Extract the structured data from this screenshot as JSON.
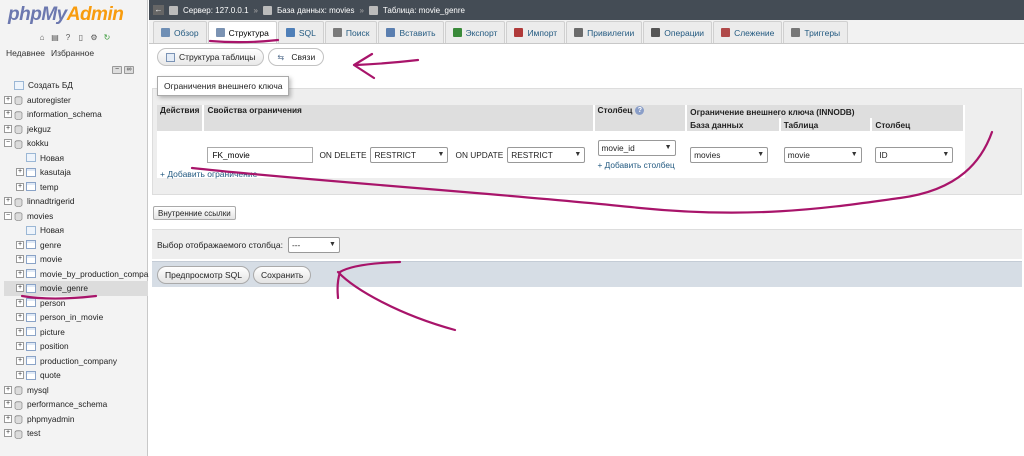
{
  "logo": {
    "php": "php",
    "my": "My",
    "admin": "Admin"
  },
  "nav": {
    "tab_recent": "Недавнее",
    "tab_favorites": "Избранное",
    "items": [
      {
        "label": "Создать БД",
        "level": 0,
        "kind": "new"
      },
      {
        "label": "autoregister",
        "level": 0,
        "kind": "db"
      },
      {
        "label": "information_schema",
        "level": 0,
        "kind": "db"
      },
      {
        "label": "jekguz",
        "level": 0,
        "kind": "db"
      },
      {
        "label": "kokku",
        "level": 0,
        "kind": "db"
      },
      {
        "label": "Новая",
        "level": 1,
        "kind": "new"
      },
      {
        "label": "kasutaja",
        "level": 1,
        "kind": "table"
      },
      {
        "label": "temp",
        "level": 1,
        "kind": "table"
      },
      {
        "label": "linnadtrigerid",
        "level": 0,
        "kind": "db"
      },
      {
        "label": "movies",
        "level": 0,
        "kind": "db"
      },
      {
        "label": "Новая",
        "level": 1,
        "kind": "new"
      },
      {
        "label": "genre",
        "level": 1,
        "kind": "table"
      },
      {
        "label": "movie",
        "level": 1,
        "kind": "table"
      },
      {
        "label": "movie_by_production_compa",
        "level": 1,
        "kind": "table"
      },
      {
        "label": "movie_genre",
        "level": 1,
        "kind": "table",
        "selected": true
      },
      {
        "label": "person",
        "level": 1,
        "kind": "table"
      },
      {
        "label": "person_in_movie",
        "level": 1,
        "kind": "table"
      },
      {
        "label": "picture",
        "level": 1,
        "kind": "table"
      },
      {
        "label": "position",
        "level": 1,
        "kind": "table"
      },
      {
        "label": "production_company",
        "level": 1,
        "kind": "table"
      },
      {
        "label": "quote",
        "level": 1,
        "kind": "table"
      },
      {
        "label": "mysql",
        "level": 0,
        "kind": "db"
      },
      {
        "label": "performance_schema",
        "level": 0,
        "kind": "db"
      },
      {
        "label": "phpmyadmin",
        "level": 0,
        "kind": "db"
      },
      {
        "label": "test",
        "level": 0,
        "kind": "db"
      }
    ]
  },
  "breadcrumb": {
    "server": "Сервер: 127.0.0.1",
    "database": "База данных: movies",
    "table": "Таблица: movie_genre"
  },
  "tabs": [
    {
      "label": "Обзор",
      "icon": "browse-icon"
    },
    {
      "label": "Структура",
      "icon": "structure-icon",
      "active": true
    },
    {
      "label": "SQL",
      "icon": "sql-icon"
    },
    {
      "label": "Поиск",
      "icon": "search-icon"
    },
    {
      "label": "Вставить",
      "icon": "insert-icon"
    },
    {
      "label": "Экспорт",
      "icon": "export-icon"
    },
    {
      "label": "Импорт",
      "icon": "import-icon"
    },
    {
      "label": "Привилегии",
      "icon": "privileges-icon"
    },
    {
      "label": "Операции",
      "icon": "operations-icon"
    },
    {
      "label": "Слежение",
      "icon": "tracking-icon"
    },
    {
      "label": "Триггеры",
      "icon": "triggers-icon"
    }
  ],
  "subtabs": {
    "structure": "Структура таблицы",
    "relations": "Связи"
  },
  "fk": {
    "legend": "Ограничения внешнего ключа",
    "headers": {
      "actions": "Действия",
      "props": "Свойства ограничения",
      "column": "Столбец",
      "fk_group": "Ограничение внешнего ключа (INNODB)",
      "database": "База данных",
      "table": "Таблица",
      "fcolumn": "Столбец"
    },
    "row": {
      "name": "FK_movie",
      "on_delete_label": "ON DELETE",
      "on_delete": "RESTRICT",
      "on_update_label": "ON UPDATE",
      "on_update": "RESTRICT",
      "column": "movie_id",
      "add_column": "+ Добавить столбец",
      "database": "movies",
      "table": "movie",
      "fcolumn": "ID"
    },
    "add_constraint": "+ Добавить ограничение"
  },
  "internal_links": "Внутренние ссылки",
  "display_column": {
    "label": "Выбор отображаемого столбца:",
    "value": "---"
  },
  "buttons": {
    "preview": "Предпросмотр SQL",
    "save": "Сохранить"
  },
  "colors": {
    "annotation": "#a8146a",
    "link": "#235a81"
  }
}
